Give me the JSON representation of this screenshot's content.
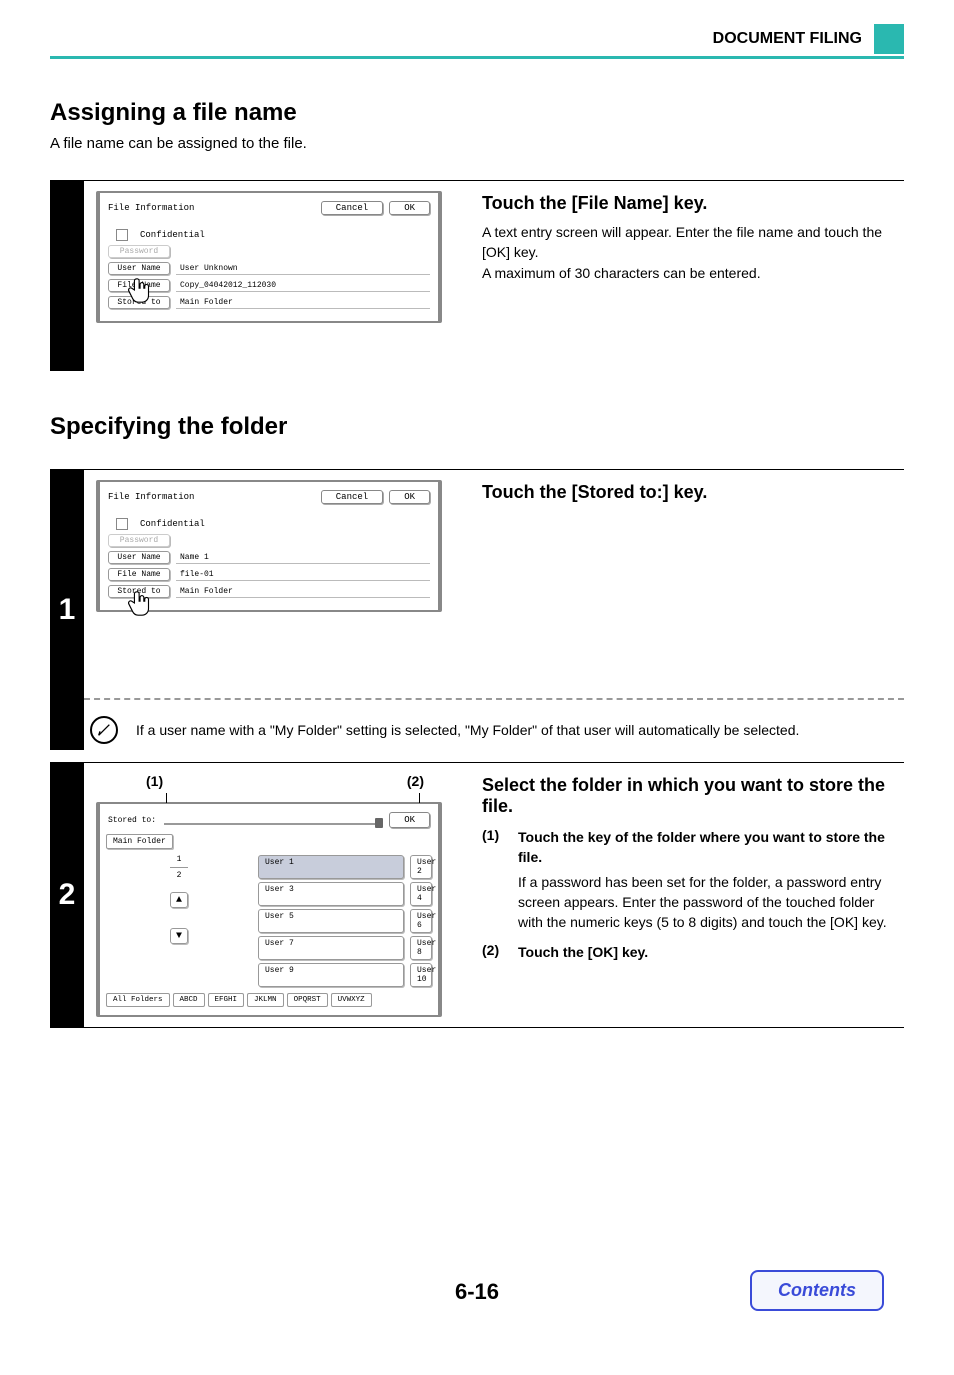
{
  "header": {
    "doc_title": "DOCUMENT FILING"
  },
  "section1": {
    "title": "Assigning a file name",
    "lead": "A file name can be assigned to the file."
  },
  "step_a": {
    "instruction_title": "Touch the [File Name] key.",
    "instruction_body1": "A text entry screen will appear. Enter the file name and touch the [OK] key.",
    "instruction_body2": "A maximum of 30 characters can be entered.",
    "panel": {
      "title": "File Information",
      "cancel": "Cancel",
      "ok": "OK",
      "confidential": "Confidential",
      "password_label": "Password",
      "username_label": "User Name",
      "username_value": "User Unknown",
      "filename_label": "File Name",
      "filename_value": "Copy_04042012_112030",
      "storedto_label": "Stored to",
      "storedto_value": "Main Folder"
    }
  },
  "section2": {
    "title": "Specifying the folder"
  },
  "step1": {
    "num": "1",
    "instruction_title": "Touch the [Stored to:] key.",
    "note": "If a user name with a \"My Folder\" setting is selected, \"My Folder\" of that user will automatically be selected.",
    "panel": {
      "title": "File Information",
      "cancel": "Cancel",
      "ok": "OK",
      "confidential": "Confidential",
      "password_label": "Password",
      "username_label": "User Name",
      "username_value": "Name 1",
      "filename_label": "File Name",
      "filename_value": "file-01",
      "storedto_label": "Stored to",
      "storedto_value": "Main Folder"
    }
  },
  "step2": {
    "num": "2",
    "callout1": "(1)",
    "callout2": "(2)",
    "instruction_title": "Select the folder in which you want to store the file.",
    "sub1_marker": "(1)",
    "sub1_title": "Touch the key of the folder where you want to store the file.",
    "sub1_detail": "If a password has been set for the folder, a password entry screen appears. Enter the password of the touched folder with the numeric keys (5 to 8 digits) and touch the [OK] key.",
    "sub2_marker": "(2)",
    "sub2_title": "Touch the [OK] key.",
    "panel": {
      "title": "Stored to:",
      "ok": "OK",
      "main_folder": "Main Folder",
      "folders": [
        "User 1",
        "User 2",
        "User 3",
        "User 4",
        "User 5",
        "User 6",
        "User 7",
        "User 8",
        "User 9",
        "User 10"
      ],
      "page_cur": "1",
      "page_tot": "2",
      "tabs": [
        "All Folders",
        "ABCD",
        "EFGHI",
        "JKLMN",
        "OPQRST",
        "UVWXYZ"
      ]
    }
  },
  "footer": {
    "page_number": "6-16",
    "contents": "Contents"
  }
}
